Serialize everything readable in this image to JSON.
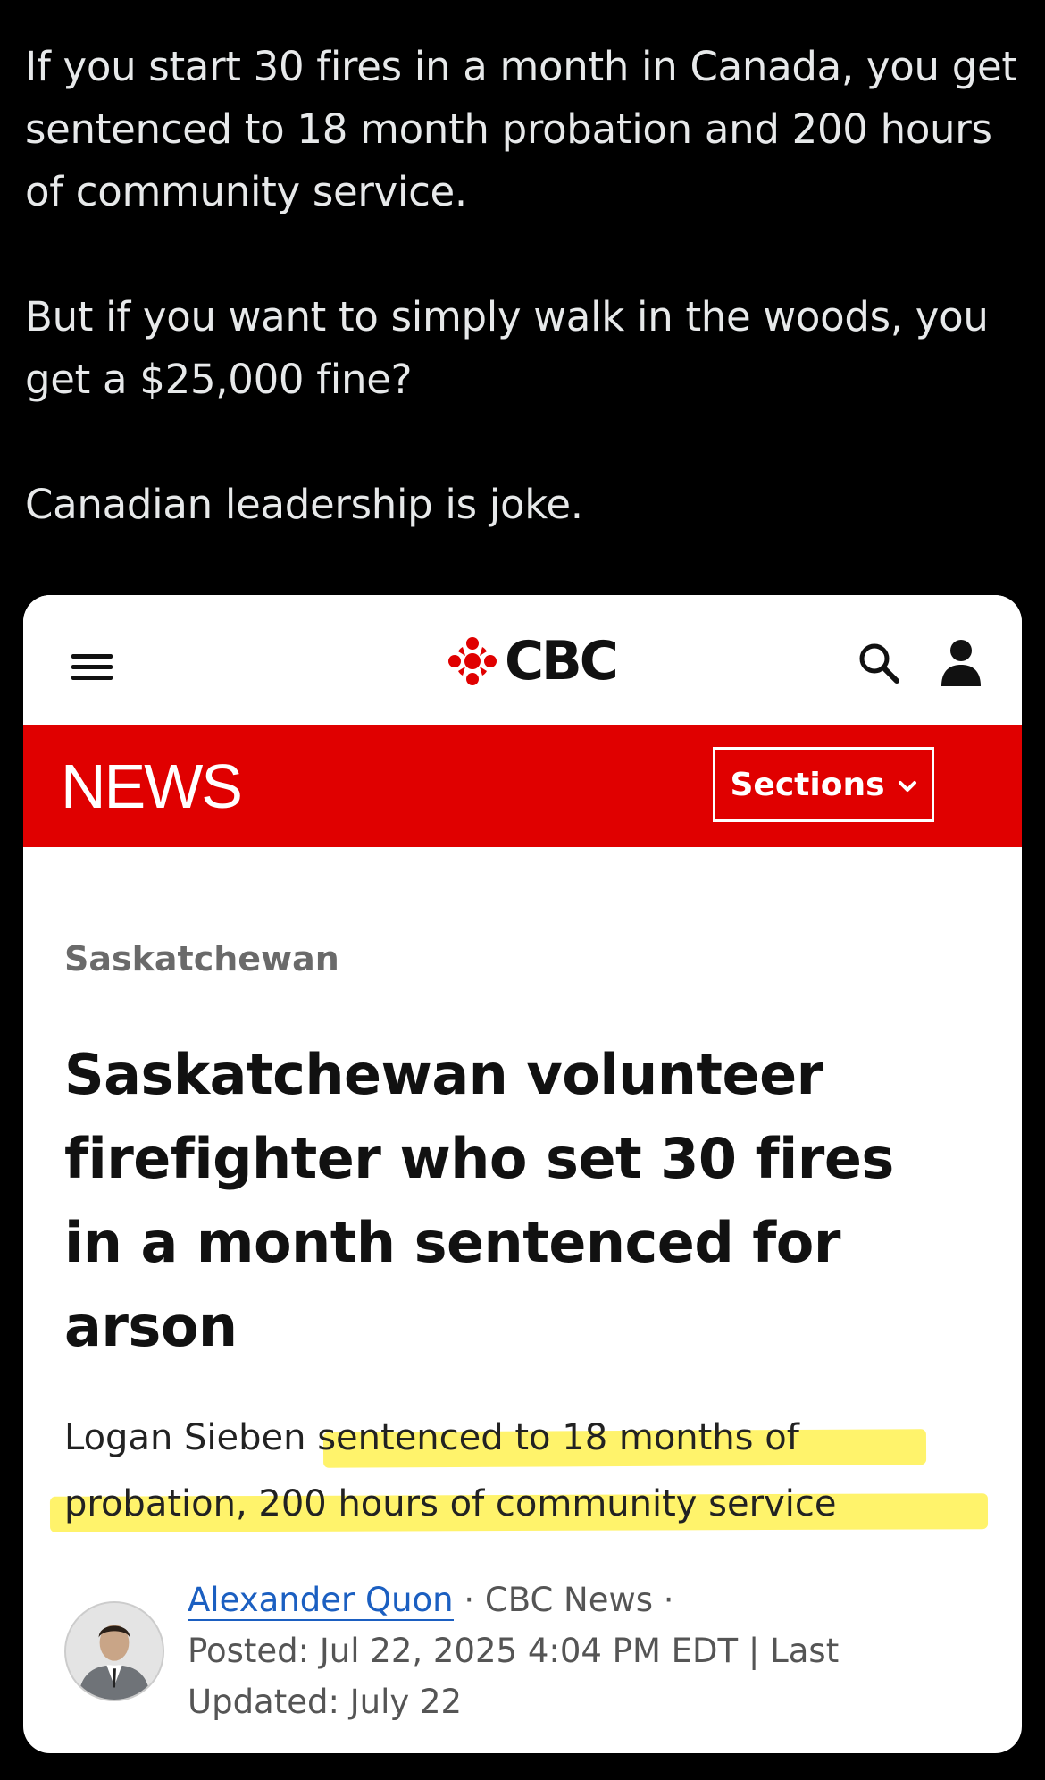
{
  "tweet": {
    "line1": "If you start 30 fires in a month in Canada, you get sentenced to 18 month probation and 200 hours of community service.",
    "line2": "But if you want to simply walk in the woods, you get a $25,000 fine?",
    "line3": "Canadian leadership is joke."
  },
  "card": {
    "brand": "CBC",
    "news_label": "NEWS",
    "sections_label": "Sections",
    "section_tag": "Saskatchewan",
    "headline": "Saskatchewan volunteer firefighter who set 30 fires in a month sentenced for arson",
    "deck_lead": "Logan Sieben",
    "deck_highlight": " sentenced to 18 months of probation, 200 hours of community service",
    "author": "Alexander Quon",
    "outlet": " · CBC News ·",
    "posted": "Posted: Jul 22, 2025 4:04 PM EDT | Last Updated: July 22"
  },
  "colors": {
    "news_red": "#e00000",
    "highlight": "#fff36b",
    "author_link": "#1b5fc1"
  },
  "icons": [
    "menu-icon",
    "cbc-gem-icon",
    "search-icon",
    "user-icon",
    "chevron-down-icon"
  ]
}
